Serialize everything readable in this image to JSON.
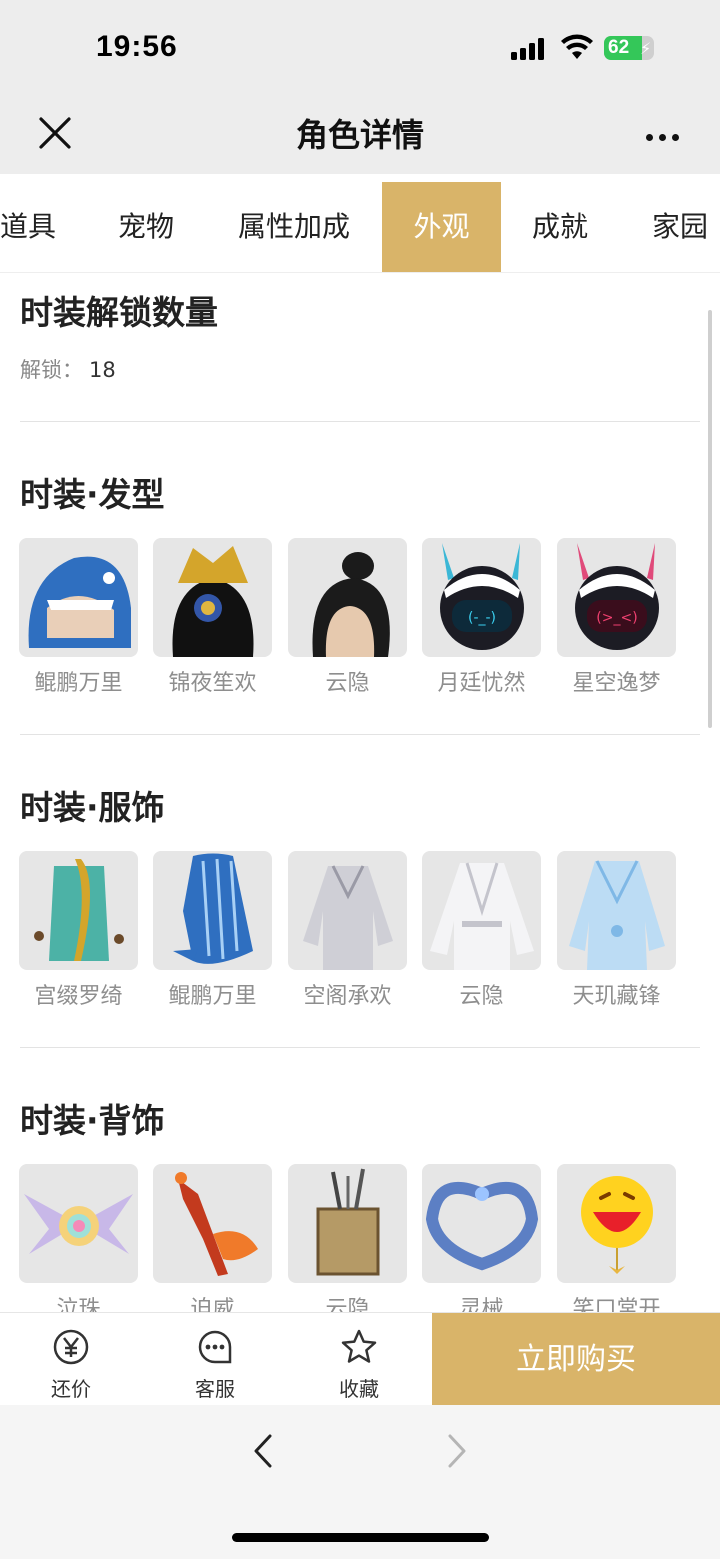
{
  "status": {
    "time": "19:56",
    "battery": "62"
  },
  "navbar": {
    "title": "角色详情"
  },
  "tabs": [
    {
      "label": "道具",
      "active": false
    },
    {
      "label": "宠物",
      "active": false
    },
    {
      "label": "属性加成",
      "active": false
    },
    {
      "label": "外观",
      "active": true
    },
    {
      "label": "成就",
      "active": false
    },
    {
      "label": "家园",
      "active": false
    }
  ],
  "unlock_section": {
    "title": "时装解锁数量",
    "label": "解锁：",
    "value": "18"
  },
  "hair_section": {
    "title": "时装·发型",
    "items": [
      "鲲鹏万里",
      "锦夜笙欢",
      "云隐",
      "月廷忧然",
      "星空逸梦"
    ]
  },
  "outfit_section": {
    "title": "时装·服饰",
    "items": [
      "宫缀罗绮",
      "鲲鹏万里",
      "空阁承欢",
      "云隐",
      "天玑藏锋"
    ]
  },
  "back_section": {
    "title": "时装·背饰",
    "items": [
      "泣珠",
      "迫威",
      "云隐",
      "灵械",
      "笑口常开"
    ]
  },
  "bottombar": {
    "bargain": "还价",
    "service": "客服",
    "favorite": "收藏",
    "buy": "立即购买"
  },
  "colors": {
    "accent": "#d9b469",
    "bg": "#ededed"
  }
}
